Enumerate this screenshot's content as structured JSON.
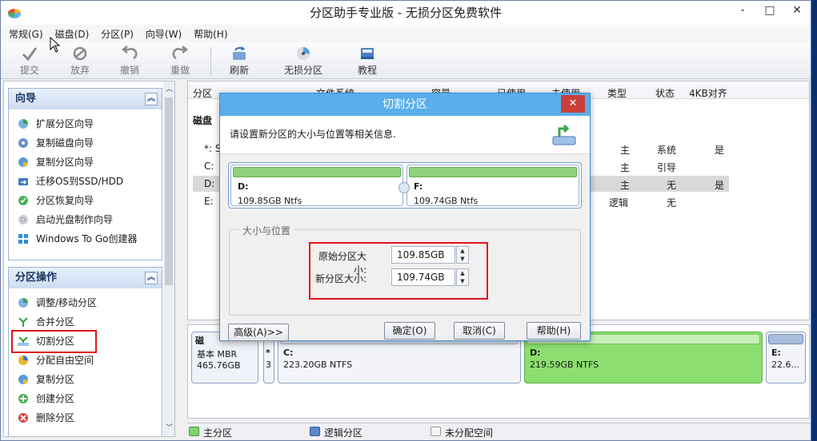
{
  "app": {
    "title": "分区助手专业版 - 无损分区免费软件",
    "window_controls": [
      "-",
      "□",
      "✕"
    ]
  },
  "menu": [
    "常规(G)",
    "磁盘(D)",
    "分区(P)",
    "向导(W)",
    "帮助(H)"
  ],
  "toolbar": {
    "commit": "提交",
    "discard": "放弃",
    "undo": "撤销",
    "redo": "重做",
    "refresh": "刷新",
    "lossless": "无损分区",
    "tutorial": "教程"
  },
  "wizard_panel": {
    "title": "向导",
    "items": [
      "扩展分区向导",
      "复制磁盘向导",
      "复制分区向导",
      "迁移OS到SSD/HDD",
      "分区恢复向导",
      "启动光盘制作向导",
      "Windows To Go创建器"
    ]
  },
  "ops_panel": {
    "title": "分区操作",
    "items": [
      "调整/移动分区",
      "合并分区",
      "切割分区",
      "分配自由空间",
      "复制分区",
      "创建分区",
      "删除分区"
    ]
  },
  "table": {
    "headers": [
      "分区",
      "文件系统",
      "容量",
      "已使用",
      "未使用",
      "类型",
      "状态",
      "4KB对齐"
    ],
    "disk_tab": "磁盘",
    "rows": [
      {
        "part": "*: S",
        "type": "主",
        "status": "系统",
        "align": "是"
      },
      {
        "part": "C:",
        "type": "主",
        "status": "引导",
        "align": ""
      },
      {
        "part": "D:",
        "type": "主",
        "status": "无",
        "align": "是"
      },
      {
        "part": "E:",
        "type": "逻辑",
        "status": "无",
        "align": ""
      }
    ]
  },
  "disk_map": {
    "disk_name": "磁",
    "disk_type": "基本 MBR",
    "disk_size": "465.76GB",
    "sys_mark": "*",
    "sys_num": "3",
    "c_label": "C:",
    "c_size": "223.20GB NTFS",
    "d_label": "D:",
    "d_size": "219.59GB NTFS",
    "e_label": "E:",
    "e_size": "22.6..."
  },
  "legend": {
    "primary": "主分区",
    "logical": "逻辑分区",
    "unallocated": "未分配空间",
    "colors": {
      "primary": "#7ed36a",
      "logical": "#5b86c8",
      "unallocated": "#f4f4f4"
    }
  },
  "dialog": {
    "title": "切割分区",
    "close": "✕",
    "instruction": "请设置新分区的大小与位置等相关信息.",
    "left_part": {
      "label": "D:",
      "size": "109.85GB Ntfs"
    },
    "right_part": {
      "label": "F:",
      "size": "109.74GB Ntfs"
    },
    "group_title": "大小与位置",
    "orig_label": "原始分区大小:",
    "orig_value": "109.85GB",
    "new_label": "新分区大小:",
    "new_value": "109.74GB",
    "advanced": "高级(A)>>",
    "ok": "确定(O)",
    "cancel": "取消(C)",
    "help": "帮助(H)"
  }
}
